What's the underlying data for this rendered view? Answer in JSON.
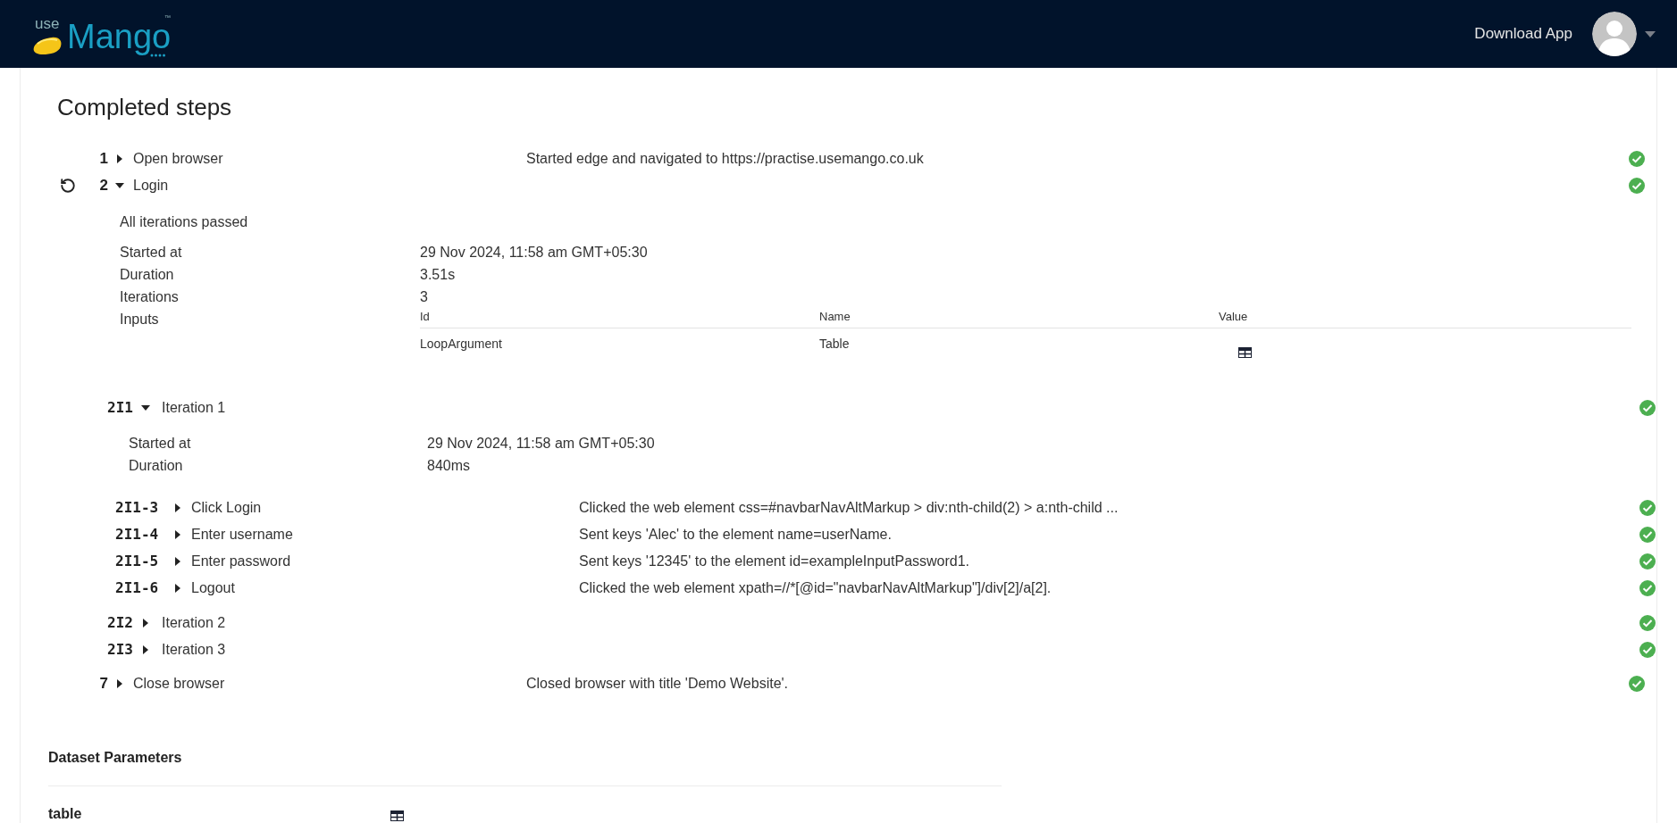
{
  "header": {
    "logo": {
      "prefix": "use",
      "name": "Mango",
      "mark": "™"
    },
    "download_label": "Download App"
  },
  "title": "Completed steps",
  "steps": [
    {
      "number": "1",
      "title": "Open browser",
      "description": "Started edge and navigated to https://practise.usemango.co.uk",
      "expanded": false,
      "passed": true,
      "retry": false
    },
    {
      "number": "2",
      "title": "Login",
      "expanded": true,
      "passed": true,
      "retry": true,
      "summary": "All iterations passed",
      "details": [
        {
          "label": "Started at",
          "value": "29 Nov 2024, 11:58 am GMT+05:30"
        },
        {
          "label": "Duration",
          "value": "3.51s"
        },
        {
          "label": "Iterations",
          "value": "3"
        }
      ],
      "inputs": {
        "label": "Inputs",
        "columns": [
          "Id",
          "Name",
          "Value"
        ],
        "rows": [
          {
            "id": "LoopArgument",
            "name": "Table"
          }
        ]
      },
      "iterations": [
        {
          "label": "2I1",
          "title": "Iteration 1",
          "expanded": true,
          "passed": true,
          "details": [
            {
              "label": "Started at",
              "value": "29 Nov 2024, 11:58 am GMT+05:30"
            },
            {
              "label": "Duration",
              "value": "840ms"
            }
          ],
          "steps": [
            {
              "number": "2I1-3",
              "title": "Click Login",
              "description": "Clicked the web element css=#navbarNavAltMarkup > div:nth-child(2) > a:nth-child ...",
              "expanded": false,
              "passed": true
            },
            {
              "number": "2I1-4",
              "title": "Enter username",
              "description": "Sent keys 'Alec' to the element name=userName.",
              "expanded": false,
              "passed": true
            },
            {
              "number": "2I1-5",
              "title": "Enter password",
              "description": "Sent keys '12345' to the element id=exampleInputPassword1.",
              "expanded": false,
              "passed": true
            },
            {
              "number": "2I1-6",
              "title": "Logout",
              "description": "Clicked the web element xpath=//*[@id=\"navbarNavAltMarkup\"]/div[2]/a[2].",
              "expanded": false,
              "passed": true
            }
          ]
        },
        {
          "label": "2I2",
          "title": "Iteration 2",
          "expanded": false,
          "passed": true
        },
        {
          "label": "2I3",
          "title": "Iteration 3",
          "expanded": false,
          "passed": true
        }
      ]
    },
    {
      "number": "7",
      "title": "Close browser",
      "description": "Closed browser with title 'Demo Website'.",
      "expanded": false,
      "passed": true,
      "retry": false
    }
  ],
  "dataset": {
    "title": "Dataset Parameters",
    "rows": [
      {
        "name": "table"
      }
    ]
  }
}
